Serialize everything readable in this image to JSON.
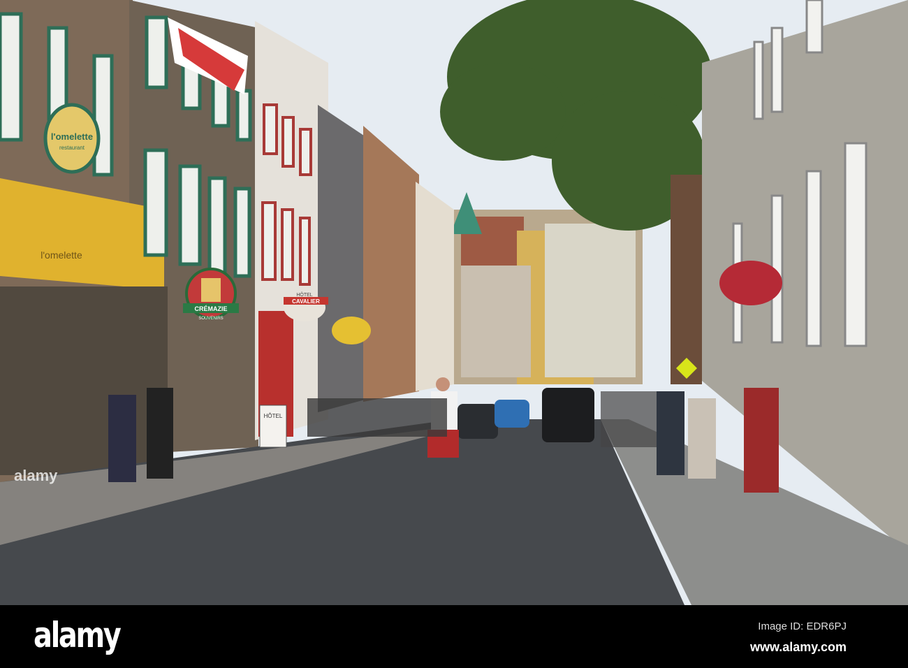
{
  "photo": {
    "signs": {
      "omelette_hanging": {
        "line1": "l'omelette",
        "line2": "restaurant"
      },
      "omelette_awning": "l'omelette",
      "cremazie": {
        "line1": "CRÉMAZIE",
        "line2": "SOUVENIRS"
      },
      "cavalier": {
        "line1": "HÔTEL",
        "line2": "CAVALIER"
      },
      "hotel_sandwich_board": "HÔTEL"
    },
    "watermark": "alamy",
    "colors": {
      "sky": "#e6ecf2",
      "road": "#46494d",
      "sidewalk": "#8d8e8c",
      "stone": "#8a7a68",
      "tree": "#3f5e2c",
      "awning": "#e0b22e"
    }
  },
  "footer": {
    "logo": "alamy",
    "image_id": "Image ID: EDR6PJ",
    "website": "www.alamy.com"
  }
}
